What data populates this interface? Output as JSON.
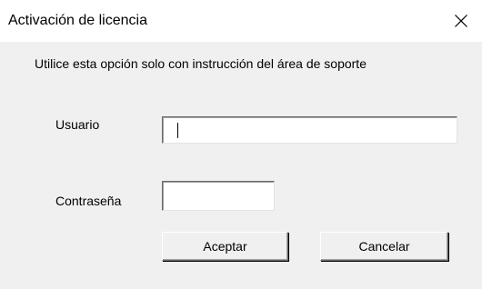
{
  "window": {
    "title": "Activación de licencia",
    "close_icon": "close-icon"
  },
  "form": {
    "instruction": "Utilice esta opción solo con instrucción del área de soporte",
    "username_label": "Usuario",
    "username_value": "",
    "password_label": "Contraseña",
    "password_value": ""
  },
  "buttons": {
    "accept_label": "Aceptar",
    "cancel_label": "Cancelar"
  },
  "colors": {
    "titlebar_bg": "#ffffff",
    "dialog_bg": "#f0f0f0",
    "input_bg": "#ffffff"
  }
}
